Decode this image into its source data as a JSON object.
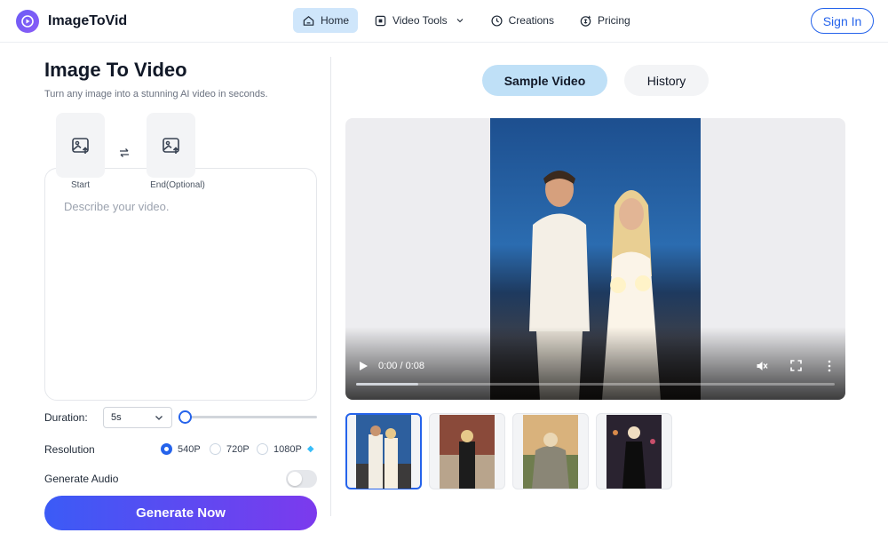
{
  "header": {
    "brand": "ImageToVid",
    "nav": [
      {
        "label": "Home",
        "icon": "home-icon",
        "active": true
      },
      {
        "label": "Video Tools",
        "icon": "video-tools-icon",
        "active": false
      },
      {
        "label": "Creations",
        "icon": "clock-icon",
        "active": false
      },
      {
        "label": "Pricing",
        "icon": "pricing-icon",
        "active": false
      }
    ],
    "signin": "Sign In"
  },
  "left": {
    "title": "Image To Video",
    "subtitle": "Turn any image into a stunning AI video in seconds.",
    "upload_start": "Start",
    "upload_end": "End(Optional)",
    "swap_icon": "swap-arrows-icon",
    "prompt_placeholder": "Describe your video.",
    "duration_label": "Duration:",
    "duration_value": "5s",
    "duration_slider_level": 0,
    "resolution_label": "Resolution",
    "resolutions": [
      "540P",
      "720P",
      "1080P"
    ],
    "resolution_selected": "540P",
    "premium_icon": "diamond-icon",
    "audio_label": "Generate Audio",
    "audio_enabled": false,
    "generate_label": "Generate Now"
  },
  "right": {
    "tabs": [
      {
        "label": "Sample Video",
        "active": true
      },
      {
        "label": "History",
        "active": false
      }
    ],
    "video": {
      "time": "0:00 / 0:08",
      "progress": 0.13
    },
    "thumbnails_selected_index": 0
  },
  "colors": {
    "accent": "#2563eb",
    "nav_active_bg": "#cfe6fb",
    "sample_tab_bg": "#bfe0f7",
    "gradient_start": "#3b5bf6",
    "gradient_end": "#7c3aed"
  }
}
